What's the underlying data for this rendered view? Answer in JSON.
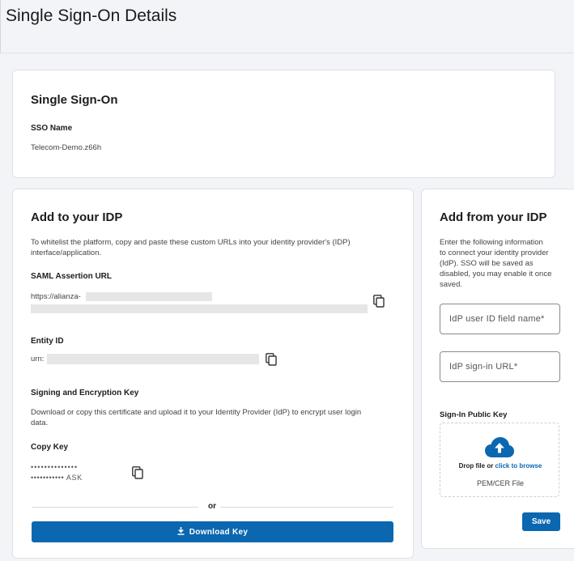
{
  "header": {
    "title": "Single Sign-On Details"
  },
  "sso_card": {
    "title": "Single Sign-On",
    "name_label": "SSO Name",
    "name_value": "Telecom-Demo.z66h"
  },
  "add_card": {
    "title": "Add to your IDP",
    "intro_line1": "To whitelist the platform, copy and paste these custom URLs into your identity provider's (IDP)",
    "intro_line2": "interface/application.",
    "saml_label": "SAML Assertion URL",
    "saml_value": "https://alianza-",
    "entity_label": "Entity ID",
    "entity_value": "urn:",
    "signing_label": "Signing and Encryption Key",
    "signing_line1": "Download or copy this certificate and upload it to your Identity Provider (IdP) to encrypt user login",
    "signing_line2": "data.",
    "copy_key_label": "Copy Key",
    "key_line1": "••••••••••••••",
    "key_line2": "••••••••••• ASK",
    "or_text": "or",
    "download_label": "Download Key"
  },
  "from_card": {
    "title": "Add from your IDP",
    "desc_lines": [
      "Enter the following information",
      "to connect your identity provider",
      "(IdP). SSO will be saved as",
      "disabled, you may enable it once",
      "saved."
    ],
    "userid_placeholder": "IdP user ID field name*",
    "signin_placeholder": "IdP sign-in URL*",
    "public_key_label": "Sign-In Public Key",
    "drop_text": "Drop file or ",
    "browse_link": "click to browse",
    "file_types": "PEM/CER File",
    "save_label": "Save"
  },
  "icons": {
    "copy": "copy-icon",
    "download": "download-icon",
    "upload": "cloud-upload-icon"
  },
  "colors": {
    "primary": "#0b67b0",
    "background": "#f3f4f8"
  }
}
